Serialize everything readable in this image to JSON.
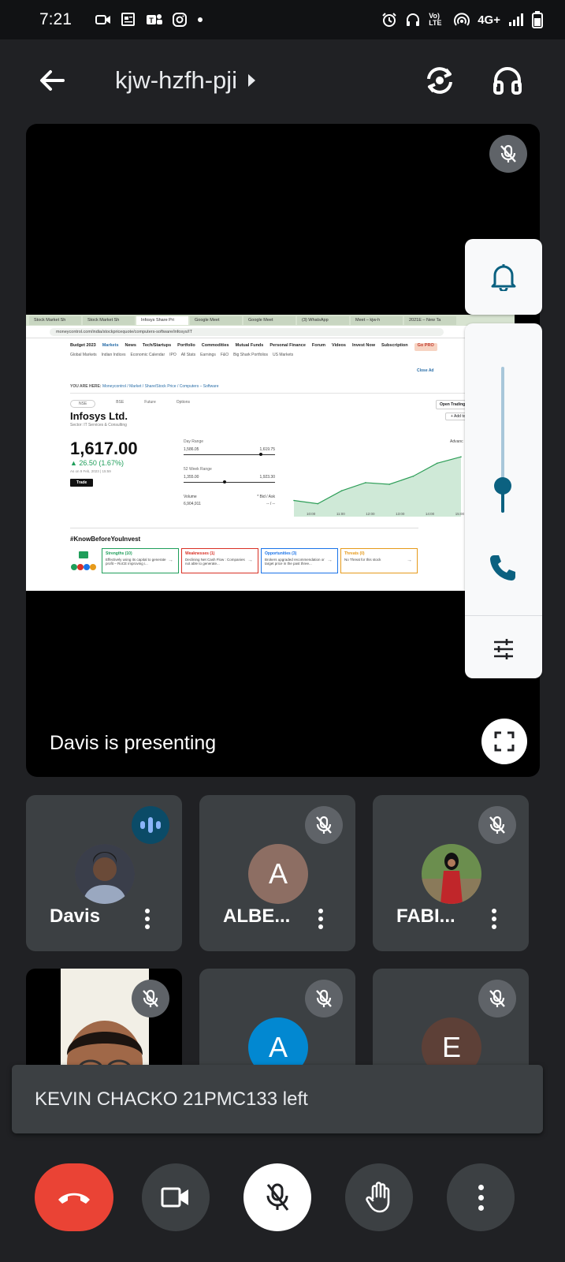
{
  "status_bar": {
    "time": "7:21",
    "network": "4G+",
    "volte": "Vo) LTE"
  },
  "top_bar": {
    "meeting_code": "kjw-hzfh-pji"
  },
  "presentation": {
    "presenting_label": "Davis is presenting",
    "shared_screen": {
      "tabs": [
        "Stock Market Sh",
        "Stock Market Sh",
        "Infosys Share Pri",
        "Google Meet",
        "Google Meet",
        "(3) WhatsApp",
        "Meet – kjw-h",
        "2021E – New Ta"
      ],
      "url": "moneycontrol.com/india/stockpricequote/computers-software/infosys/IT",
      "nav_main": [
        "Budget 2023",
        "Markets",
        "News",
        "Tech/Startups",
        "Portfolio",
        "Commodities",
        "Mutual Funds",
        "Personal Finance",
        "Forum",
        "Videos",
        "Invest Now",
        "Subscription"
      ],
      "nav_pro": "Go PRO",
      "nav_sub": [
        "Global Markets",
        "Indian Indices",
        "Economic Calendar",
        "IPO",
        "All Stats",
        "Earnings",
        "F&O",
        "Big Shark Portfolios",
        "US Markets"
      ],
      "close_ad": "Close Ad",
      "breadcrumb_prefix": "YOU ARE HERE:",
      "breadcrumb": "Moneycontrol / Market / Share/Stock Price / Computers – Software",
      "exchange_tabs": [
        "NSE",
        "BSE",
        "Future",
        "Options"
      ],
      "open_trading": "Open Trading A",
      "add_btn": "+ Add to",
      "company": "Infosys Ltd.",
      "sector": "Sector: IT Services & Consulting",
      "price": "1,617.00",
      "change": "▲ 26.50 (1.67%)",
      "as_of": "As on 9 Feb, 2023 | 15:59",
      "trade_btn": "Trade",
      "day_range_label": "Day Range",
      "day_low": "1,586.05",
      "day_high": "1,619.75",
      "wk52_label": "52 Week Range",
      "wk52_low": "1,355.00",
      "wk52_high": "1,923.30",
      "volume_label": "Volume",
      "volume": "6,904,911",
      "bid_ask_label": "* Bid / Ask",
      "bid_ask": "-- / --",
      "advanced_chart": "Advanc",
      "chart_times": [
        "10:00",
        "11:00",
        "12:00",
        "13:00",
        "14:00",
        "15:00"
      ],
      "chart_data": {
        "type": "area",
        "x": [
          "09:15",
          "10:00",
          "11:00",
          "12:00",
          "13:00",
          "14:00",
          "15:00",
          "15:30"
        ],
        "values": [
          1590,
          1588,
          1596,
          1601,
          1600,
          1605,
          1613,
          1617
        ],
        "ylim": [
          1580,
          1620
        ],
        "color": "#2e9e58"
      },
      "know_before": "#KnowBeforeYouInvest",
      "swot_cards": [
        {
          "title": "Strengths (10)",
          "text": "Effectively using its capital to generate profit – RoCE improving i...",
          "color": "#1f9e5a"
        },
        {
          "title": "Weaknesses (1)",
          "text": "Declining Net Cash Flow : Companies not able to generate...",
          "color": "#d93025"
        },
        {
          "title": "Opportunities (3)",
          "text": "Brokers upgraded recommendation or target price in the past three...",
          "color": "#1a73e8"
        },
        {
          "title": "Threats (0)",
          "text": "No Threat for this stock",
          "color": "#e69a1a"
        }
      ]
    }
  },
  "participants": [
    {
      "name": "Davis",
      "state": "speaking",
      "avatar_color": "#5a4a3a"
    },
    {
      "name": "ALBE...",
      "state": "muted",
      "initial": "A",
      "avatar_color": "#8d6e63"
    },
    {
      "name": "FABI...",
      "state": "muted",
      "avatar_color": "#6b8e4e"
    },
    {
      "name": "",
      "state": "muted",
      "avatar_color": "#000000"
    },
    {
      "name": "",
      "state": "muted",
      "initial": "A",
      "avatar_color": "#0288d1"
    },
    {
      "name": "",
      "state": "muted",
      "initial": "E",
      "avatar_color": "#5d4037"
    }
  ],
  "toast": {
    "message": "KEVIN CHACKO 21PMC133 left"
  },
  "volume_panel": {
    "call_volume_level": 0.17
  },
  "colors": {
    "end_call": "#ea4335",
    "accent": "#0b6180"
  }
}
